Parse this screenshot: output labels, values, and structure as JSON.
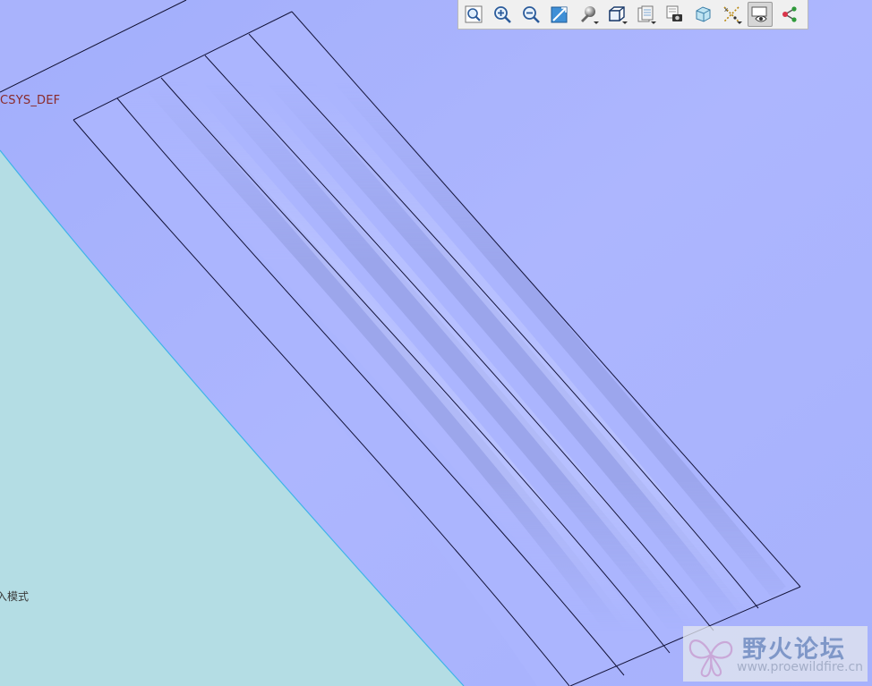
{
  "viewport": {
    "background_color": "#a9b3fc",
    "datum_plane_color": "#b4dde4",
    "model_face_color": "#aab4fe",
    "edge_color": "#1a1a3a",
    "csys_label": "CSYS_DEF",
    "mode_label": "入模式"
  },
  "toolbar": {
    "buttons": [
      {
        "name": "refit-button",
        "icon": "refit-icon",
        "active": false,
        "dropdown": false
      },
      {
        "name": "zoom-in-button",
        "icon": "zoom-in-icon",
        "active": false,
        "dropdown": false
      },
      {
        "name": "zoom-out-button",
        "icon": "zoom-out-icon",
        "active": false,
        "dropdown": false
      },
      {
        "name": "repaint-button",
        "icon": "repaint-icon",
        "active": false,
        "dropdown": false
      },
      {
        "name": "display-style-button",
        "icon": "shaded-sphere-icon",
        "active": false,
        "dropdown": true
      },
      {
        "name": "saved-orientations-button",
        "icon": "cube-view-icon",
        "active": false,
        "dropdown": true
      },
      {
        "name": "view-manager-button",
        "icon": "view-manager-icon",
        "active": false,
        "dropdown": true
      },
      {
        "name": "layers-button",
        "icon": "layers-camera-icon",
        "active": false,
        "dropdown": false
      },
      {
        "name": "perspective-button",
        "icon": "perspective-box-icon",
        "active": false,
        "dropdown": false
      },
      {
        "name": "datum-display-button",
        "icon": "datum-display-icon",
        "active": false,
        "dropdown": true
      },
      {
        "name": "annotation-display-button",
        "icon": "annotation-eye-icon",
        "active": true,
        "dropdown": false
      },
      {
        "name": "spin-center-button",
        "icon": "spin-center-icon",
        "active": false,
        "dropdown": false
      }
    ]
  },
  "watermark": {
    "title": "野火论坛",
    "url": "www.proewildfire.cn"
  }
}
